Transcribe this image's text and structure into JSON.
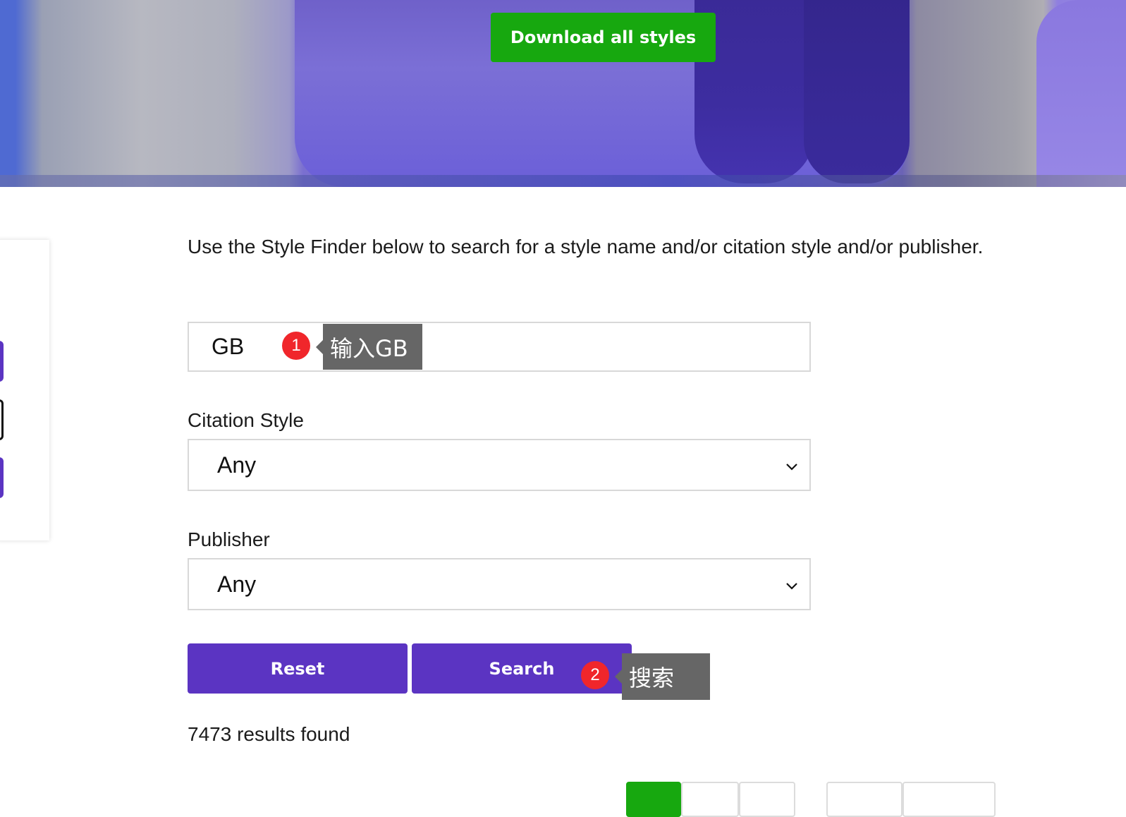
{
  "hero": {
    "download_label": "Download all styles"
  },
  "intro_text": "Use the Style Finder below to search for a style name and/or citation style and/or publisher.",
  "search": {
    "value": "GB"
  },
  "citation_style": {
    "label": "Citation Style",
    "selected": "Any"
  },
  "publisher": {
    "label": "Publisher",
    "selected": "Any"
  },
  "buttons": {
    "reset_label": "Reset",
    "search_label": "Search"
  },
  "results_text": "7473 results found",
  "annotations": [
    {
      "number": "1",
      "text": "输入GB"
    },
    {
      "number": "2",
      "text": "搜索"
    }
  ],
  "colors": {
    "primary_purple": "#5b34c2",
    "download_green": "#17a80f",
    "annotation_red": "#f0262b",
    "tooltip_gray": "#666666"
  }
}
